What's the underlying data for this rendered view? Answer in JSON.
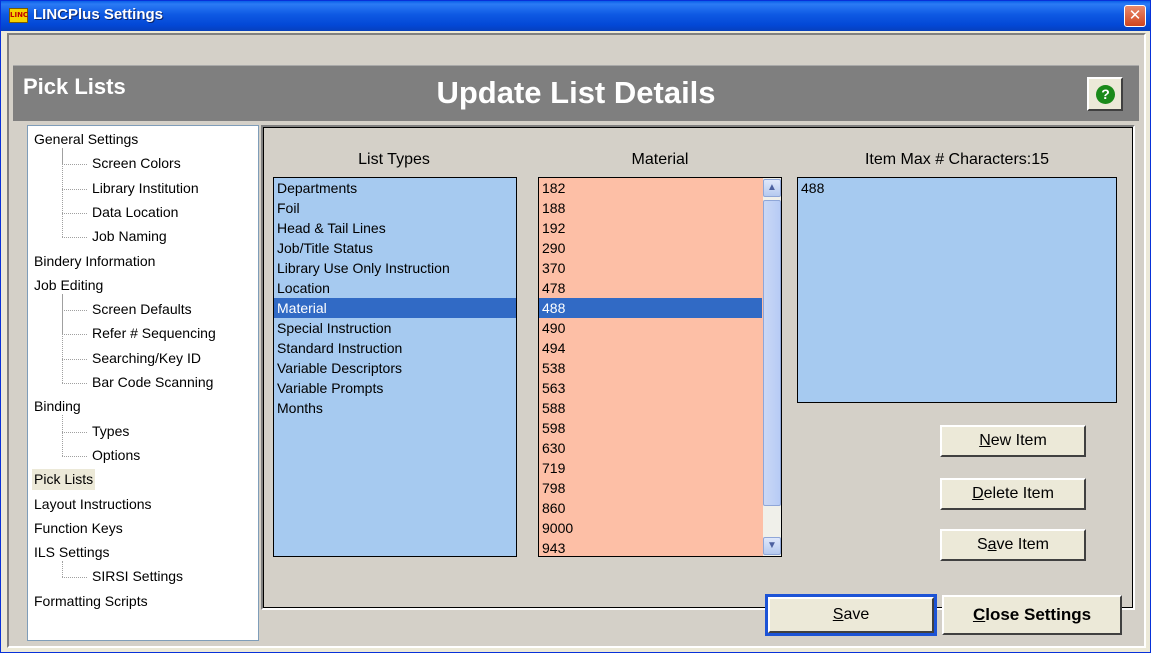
{
  "window": {
    "title": "LINCPlus Settings",
    "app_icon_text": "LINC",
    "close_glyph": "✕"
  },
  "header": {
    "section_title": "Pick Lists",
    "page_title": "Update List Details",
    "help_glyph": "?"
  },
  "tree": {
    "items": [
      {
        "label": "General Settings",
        "level": 0
      },
      {
        "label": "Screen Colors",
        "level": 1
      },
      {
        "label": "Library Institution",
        "level": 1
      },
      {
        "label": "Data Location",
        "level": 1
      },
      {
        "label": "Job Naming",
        "level": 1
      },
      {
        "label": "Bindery Information",
        "level": 0
      },
      {
        "label": "Job Editing",
        "level": 0
      },
      {
        "label": "Screen Defaults",
        "level": 1
      },
      {
        "label": "Refer # Sequencing",
        "level": 1
      },
      {
        "label": "Searching/Key ID",
        "level": 1
      },
      {
        "label": "Bar Code Scanning",
        "level": 1
      },
      {
        "label": "Binding",
        "level": 0
      },
      {
        "label": "Types",
        "level": 1
      },
      {
        "label": "Options",
        "level": 1
      },
      {
        "label": "Pick Lists",
        "level": 0,
        "selected": true
      },
      {
        "label": "Layout Instructions",
        "level": 0
      },
      {
        "label": "Function Keys",
        "level": 0
      },
      {
        "label": "ILS Settings",
        "level": 0
      },
      {
        "label": "SIRSI Settings",
        "level": 1
      },
      {
        "label": "Formatting Scripts",
        "level": 0
      }
    ]
  },
  "list_types": {
    "label": "List Types",
    "items": [
      "Departments",
      "Foil",
      "Head & Tail Lines",
      "Job/Title Status",
      "Library Use Only Instruction",
      "Location",
      "Material",
      "Special Instruction",
      "Standard Instruction",
      "Variable Descriptors",
      "Variable Prompts",
      "Months"
    ],
    "selected": "Material"
  },
  "material": {
    "label": "Material",
    "items": [
      "182",
      "188",
      "192",
      "290",
      "370",
      "478",
      "488",
      "490",
      "494",
      "538",
      "563",
      "588",
      "598",
      "630",
      "719",
      "798",
      "860",
      "9000",
      "943"
    ],
    "selected": "488"
  },
  "item_detail": {
    "label": "Item Max # Characters:15",
    "value": "488"
  },
  "buttons": {
    "new_item": {
      "pre": "",
      "key": "N",
      "post": "ew Item"
    },
    "delete_item": {
      "pre": "",
      "key": "D",
      "post": "elete Item"
    },
    "save_item": {
      "pre": "S",
      "key": "a",
      "post": "ve Item"
    },
    "save": {
      "pre": "",
      "key": "S",
      "post": "ave"
    },
    "close_settings": {
      "pre": "",
      "key": "C",
      "post": "lose Settings"
    }
  },
  "colors": {
    "titlebar": "#0348d6",
    "header_bg": "#7f7f7f",
    "list_blue": "#a6caf0",
    "list_salmon": "#fdbfa6",
    "selection": "#316ac5",
    "help_green": "#1a8a1a"
  }
}
